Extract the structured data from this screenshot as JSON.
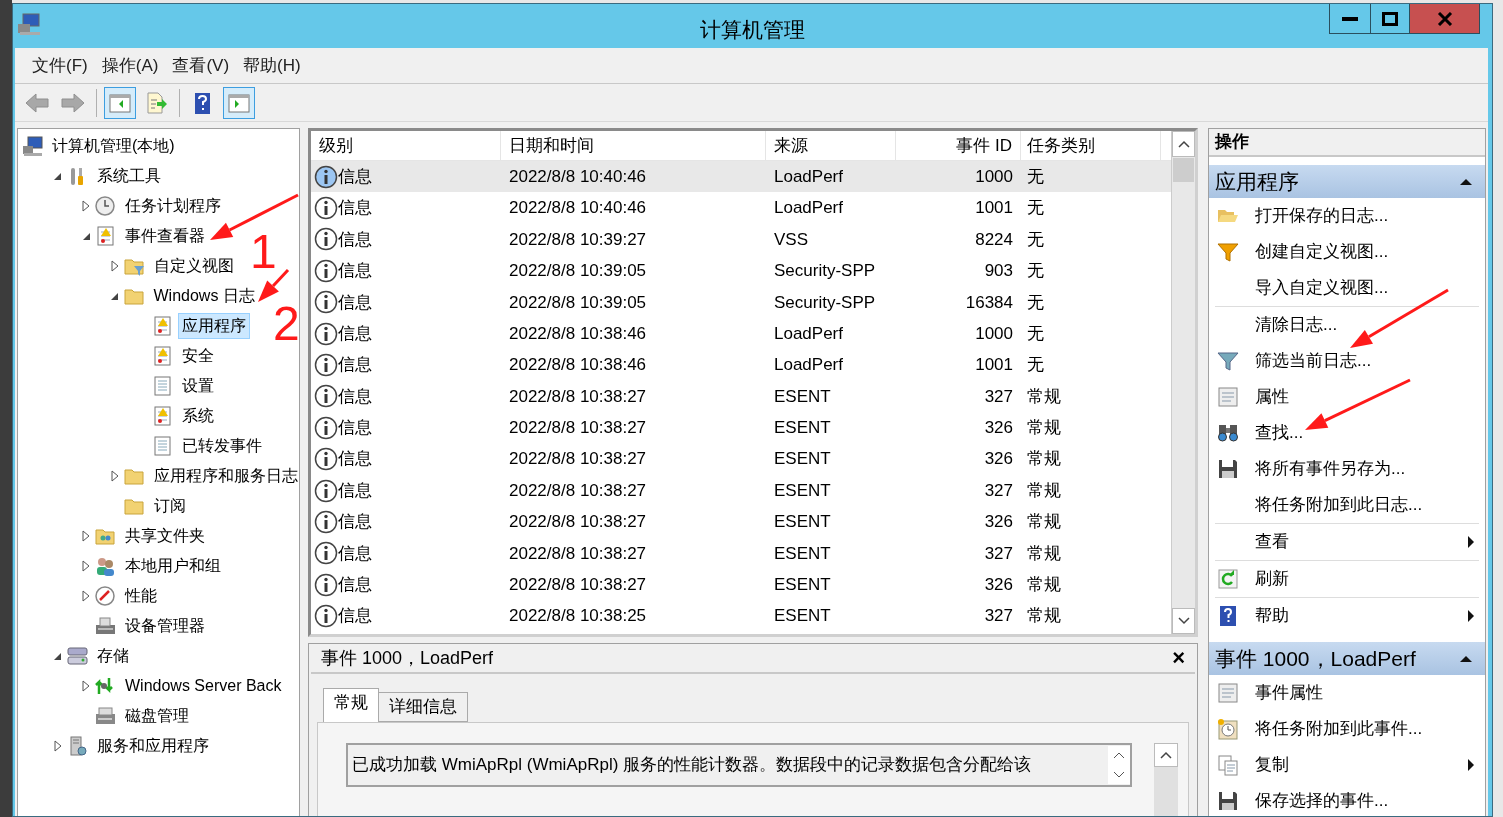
{
  "window": {
    "title": "计算机管理"
  },
  "menu": [
    "文件(F)",
    "操作(A)",
    "查看(V)",
    "帮助(H)"
  ],
  "toolbar": [
    {
      "kind": "back",
      "disabled": true
    },
    {
      "kind": "forward",
      "disabled": true
    },
    {
      "kind": "sep"
    },
    {
      "kind": "tree-pane",
      "selected": true
    },
    {
      "kind": "export",
      "selected": false
    },
    {
      "kind": "sep"
    },
    {
      "kind": "help",
      "selected": false
    },
    {
      "kind": "action-pane",
      "selected": true
    }
  ],
  "tree": [
    {
      "label": "计算机管理(本地)",
      "kind": "computer",
      "selected": false,
      "children": [
        {
          "label": "系统工具",
          "kind": "tools",
          "expanded": true,
          "selected": false,
          "children": [
            {
              "label": "任务计划程序",
              "kind": "clock",
              "expanded": false,
              "selected": false
            },
            {
              "label": "事件查看器",
              "kind": "log",
              "expanded": true,
              "selected": false,
              "children": [
                {
                  "label": "自定义视图",
                  "kind": "filter-folder",
                  "expanded": false,
                  "selected": false
                },
                {
                  "label": "Windows 日志",
                  "kind": "folder",
                  "expanded": true,
                  "selected": false,
                  "children": [
                    {
                      "label": "应用程序",
                      "kind": "log",
                      "selected": true
                    },
                    {
                      "label": "安全",
                      "kind": "log",
                      "selected": false
                    },
                    {
                      "label": "设置",
                      "kind": "page",
                      "selected": false
                    },
                    {
                      "label": "系统",
                      "kind": "log",
                      "selected": false
                    },
                    {
                      "label": "已转发事件",
                      "kind": "page",
                      "selected": false
                    }
                  ]
                },
                {
                  "label": "应用程序和服务日志",
                  "kind": "folder",
                  "expanded": false,
                  "selected": false
                },
                {
                  "label": "订阅",
                  "kind": "folder",
                  "selected": false
                }
              ]
            },
            {
              "label": "共享文件夹",
              "kind": "share",
              "expanded": false,
              "selected": false
            },
            {
              "label": "本地用户和组",
              "kind": "users",
              "expanded": false,
              "selected": false
            },
            {
              "label": "性能",
              "kind": "gauge",
              "expanded": false,
              "selected": false
            },
            {
              "label": "设备管理器",
              "kind": "device",
              "selected": false
            }
          ]
        },
        {
          "label": "存储",
          "kind": "storage",
          "expanded": true,
          "selected": false,
          "children": [
            {
              "label": "Windows Server Back",
              "kind": "backup",
              "expanded": false,
              "selected": false
            },
            {
              "label": "磁盘管理",
              "kind": "disk",
              "selected": false
            }
          ]
        },
        {
          "label": "服务和应用程序",
          "kind": "server",
          "expanded": false,
          "selected": false
        }
      ]
    }
  ],
  "events": {
    "columns": [
      "级别",
      "日期和时间",
      "来源",
      "事件 ID",
      "任务类别"
    ],
    "rows": [
      {
        "level": "信息",
        "datetime": "2022/8/8 10:40:46",
        "source": "LoadPerf",
        "event_id": "1000",
        "task": "无",
        "selected": true
      },
      {
        "level": "信息",
        "datetime": "2022/8/8 10:40:46",
        "source": "LoadPerf",
        "event_id": "1001",
        "task": "无",
        "selected": false
      },
      {
        "level": "信息",
        "datetime": "2022/8/8 10:39:27",
        "source": "VSS",
        "event_id": "8224",
        "task": "无",
        "selected": false
      },
      {
        "level": "信息",
        "datetime": "2022/8/8 10:39:05",
        "source": "Security-SPP",
        "event_id": "903",
        "task": "无",
        "selected": false
      },
      {
        "level": "信息",
        "datetime": "2022/8/8 10:39:05",
        "source": "Security-SPP",
        "event_id": "16384",
        "task": "无",
        "selected": false
      },
      {
        "level": "信息",
        "datetime": "2022/8/8 10:38:46",
        "source": "LoadPerf",
        "event_id": "1000",
        "task": "无",
        "selected": false
      },
      {
        "level": "信息",
        "datetime": "2022/8/8 10:38:46",
        "source": "LoadPerf",
        "event_id": "1001",
        "task": "无",
        "selected": false
      },
      {
        "level": "信息",
        "datetime": "2022/8/8 10:38:27",
        "source": "ESENT",
        "event_id": "327",
        "task": "常规",
        "selected": false
      },
      {
        "level": "信息",
        "datetime": "2022/8/8 10:38:27",
        "source": "ESENT",
        "event_id": "326",
        "task": "常规",
        "selected": false
      },
      {
        "level": "信息",
        "datetime": "2022/8/8 10:38:27",
        "source": "ESENT",
        "event_id": "326",
        "task": "常规",
        "selected": false
      },
      {
        "level": "信息",
        "datetime": "2022/8/8 10:38:27",
        "source": "ESENT",
        "event_id": "327",
        "task": "常规",
        "selected": false
      },
      {
        "level": "信息",
        "datetime": "2022/8/8 10:38:27",
        "source": "ESENT",
        "event_id": "326",
        "task": "常规",
        "selected": false
      },
      {
        "level": "信息",
        "datetime": "2022/8/8 10:38:27",
        "source": "ESENT",
        "event_id": "327",
        "task": "常规",
        "selected": false
      },
      {
        "level": "信息",
        "datetime": "2022/8/8 10:38:27",
        "source": "ESENT",
        "event_id": "326",
        "task": "常规",
        "selected": false
      },
      {
        "level": "信息",
        "datetime": "2022/8/8 10:38:25",
        "source": "ESENT",
        "event_id": "327",
        "task": "常规",
        "selected": false
      }
    ]
  },
  "details": {
    "title": "事件 1000，LoadPerf",
    "close": "×",
    "tabs": [
      {
        "label": "常规",
        "selected": true
      },
      {
        "label": "详细信息",
        "selected": false
      }
    ],
    "message": "已成功加载 WmiApRpl (WmiApRpl) 服务的性能计数器。数据段中的记录数据包含分配给该"
  },
  "actions": {
    "title": "操作",
    "sections": [
      {
        "title": "应用程序",
        "expanded": true,
        "items": [
          {
            "label": "打开保存的日志...",
            "kind": "open-folder",
            "separator_before": false,
            "submenu": false
          },
          {
            "label": "创建自定义视图...",
            "kind": "funnel-color",
            "separator_before": false,
            "submenu": false
          },
          {
            "label": "导入自定义视图...",
            "kind": "none",
            "separator_before": false,
            "submenu": false
          },
          {
            "label": "清除日志...",
            "kind": "none",
            "separator_before": true,
            "submenu": false
          },
          {
            "label": "筛选当前日志...",
            "kind": "funnel",
            "separator_before": false,
            "submenu": false
          },
          {
            "label": "属性",
            "kind": "properties",
            "separator_before": false,
            "submenu": false
          },
          {
            "label": "查找...",
            "kind": "binoculars",
            "separator_before": false,
            "submenu": false
          },
          {
            "label": "将所有事件另存为...",
            "kind": "floppy",
            "separator_before": false,
            "submenu": false
          },
          {
            "label": "将任务附加到此日志...",
            "kind": "none",
            "separator_before": false,
            "submenu": false
          },
          {
            "label": "查看",
            "kind": "none",
            "separator_before": true,
            "submenu": true
          },
          {
            "label": "刷新",
            "kind": "refresh",
            "separator_before": true,
            "submenu": false
          },
          {
            "label": "帮助",
            "kind": "help",
            "separator_before": true,
            "submenu": true
          }
        ]
      },
      {
        "title": "事件 1000，LoadPerf",
        "expanded": true,
        "items": [
          {
            "label": "事件属性",
            "kind": "properties",
            "separator_before": false,
            "submenu": false
          },
          {
            "label": "将任务附加到此事件...",
            "kind": "clock",
            "separator_before": false,
            "submenu": false
          },
          {
            "label": "复制",
            "kind": "copy",
            "separator_before": false,
            "submenu": true
          },
          {
            "label": "保存选择的事件...",
            "kind": "floppy",
            "separator_before": false,
            "submenu": false
          }
        ]
      }
    ]
  },
  "annotations": [
    {
      "kind": "number",
      "text": "1"
    },
    {
      "kind": "number",
      "text": "2"
    },
    {
      "kind": "arrow"
    },
    {
      "kind": "arrow"
    },
    {
      "kind": "arrow"
    },
    {
      "kind": "arrow"
    }
  ]
}
